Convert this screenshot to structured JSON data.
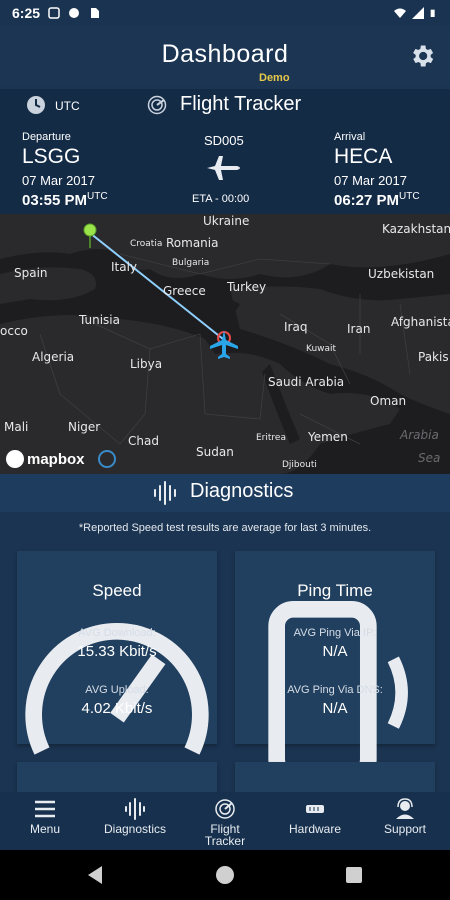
{
  "status_bar": {
    "time": "6:25"
  },
  "header": {
    "title": "Dashboard",
    "badge": "Demo"
  },
  "tracker": {
    "utc_label": "UTC",
    "title": "Flight Tracker",
    "flight_number": "SD005",
    "eta": "ETA - 00:00",
    "departure": {
      "label": "Departure",
      "code": "LSGG",
      "date": "07 Mar 2017",
      "time": "03:55 PM",
      "tz": "UTC"
    },
    "arrival": {
      "label": "Arrival",
      "code": "HECA",
      "date": "07 Mar 2017",
      "time": "06:27 PM",
      "tz": "UTC"
    }
  },
  "map": {
    "labels": [
      "Ukraine",
      "Kazakhstan",
      "Croatia",
      "Romania",
      "Bulgaria",
      "Spain",
      "Italy",
      "Uzbekistan",
      "Greece",
      "Turkey",
      "Tunisia",
      "Iraq",
      "Iran",
      "Afghanista",
      "occo",
      "Kuwait",
      "Pakis",
      "Algeria",
      "Libya",
      "Saudi Arabia",
      "Oman",
      "Mali",
      "Niger",
      "Eritrea",
      "Yemen",
      "Arabia",
      "Chad",
      "Sudan",
      "Sea",
      "Djibouti"
    ],
    "attribution": "mapbox",
    "route_color": "#8fd0ff",
    "origin_color": "#9be34a",
    "plane_color": "#2aa6e8"
  },
  "diagnostics": {
    "title": "Diagnostics",
    "note": "*Reported Speed test results are average for last 3 minutes.",
    "speed": {
      "title": "Speed",
      "download_label": "AVG Download:",
      "download_value": "15.33 Kbit/s",
      "upload_label": "AVG Upload:",
      "upload_value": "4.02 Kbit/s"
    },
    "ping": {
      "title": "Ping Time",
      "ip_label": "AVG Ping Via IP:",
      "ip_value": "N/A",
      "dns_label": "AVG Ping Via DNS:",
      "dns_value": "N/A"
    }
  },
  "nav": {
    "items": [
      {
        "label": "Menu",
        "icon": "hamburger-icon"
      },
      {
        "label": "Diagnostics",
        "icon": "waveform-icon"
      },
      {
        "label": "Flight Tracker",
        "icon": "radar-icon"
      },
      {
        "label": "Hardware",
        "icon": "hardware-icon"
      },
      {
        "label": "Support",
        "icon": "support-agent-icon"
      }
    ]
  },
  "colors": {
    "background": "#1b3451",
    "accent_demo": "#e6c84a"
  }
}
